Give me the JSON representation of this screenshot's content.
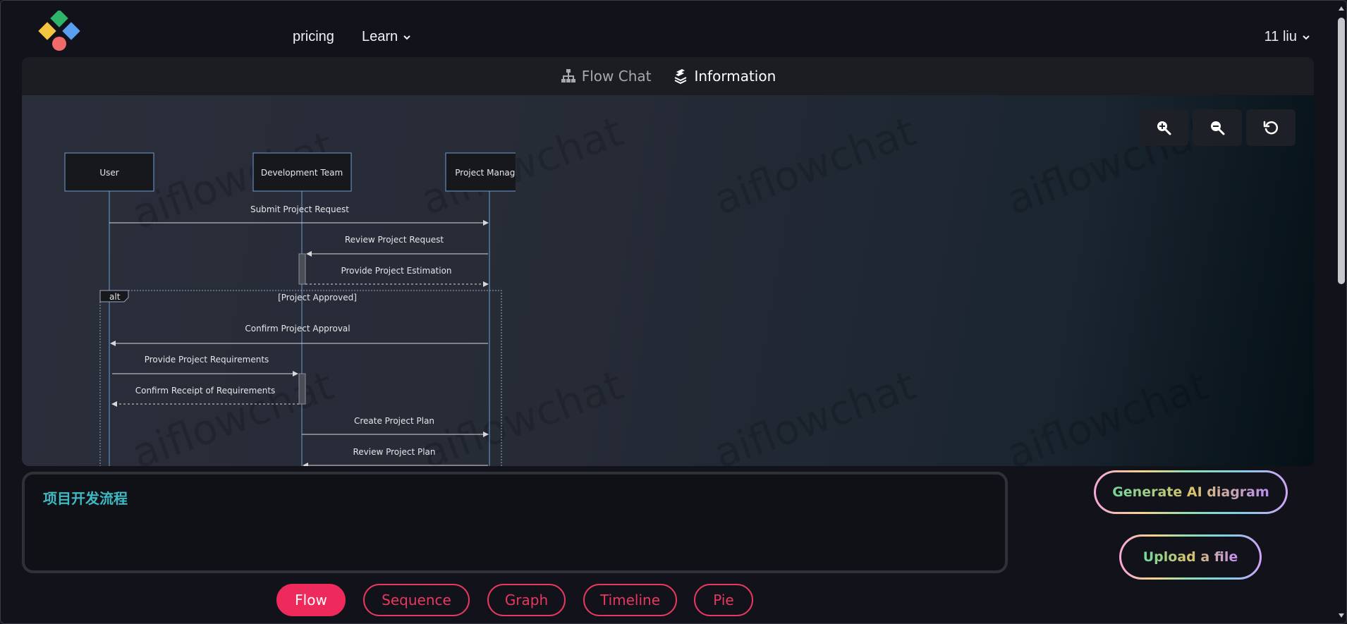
{
  "nav": {
    "pricing": "pricing",
    "learn": "Learn",
    "user": "11 liu"
  },
  "tabs": {
    "flow_chat": "Flow Chat",
    "information": "Information"
  },
  "watermark": "aiflowchat",
  "zoom": {
    "zoom_in_icon": "zoom-in-icon",
    "zoom_out_icon": "zoom-out-icon",
    "reset_icon": "reset-icon"
  },
  "diagram": {
    "participants": [
      "User",
      "Development Team",
      "Project Manager"
    ],
    "messages": [
      "Submit Project Request",
      "Review Project Request",
      "Provide Project Estimation",
      "Confirm Project Approval",
      "Provide Project Requirements",
      "Confirm Receipt of Requirements",
      "Create Project Plan",
      "Review Project Plan"
    ],
    "alt_label": "alt",
    "alt_condition": "[Project Approved]"
  },
  "prompt": {
    "text": "项目开发流程"
  },
  "buttons": {
    "generate": "Generate AI diagram",
    "upload": "Upload a file"
  },
  "types": [
    "Flow",
    "Sequence",
    "Graph",
    "Timeline",
    "Pie"
  ],
  "colors": {
    "accent": "#ee2a5c",
    "prompt_text": "#3fb9c3",
    "lifeline": "#6f9ed6"
  }
}
